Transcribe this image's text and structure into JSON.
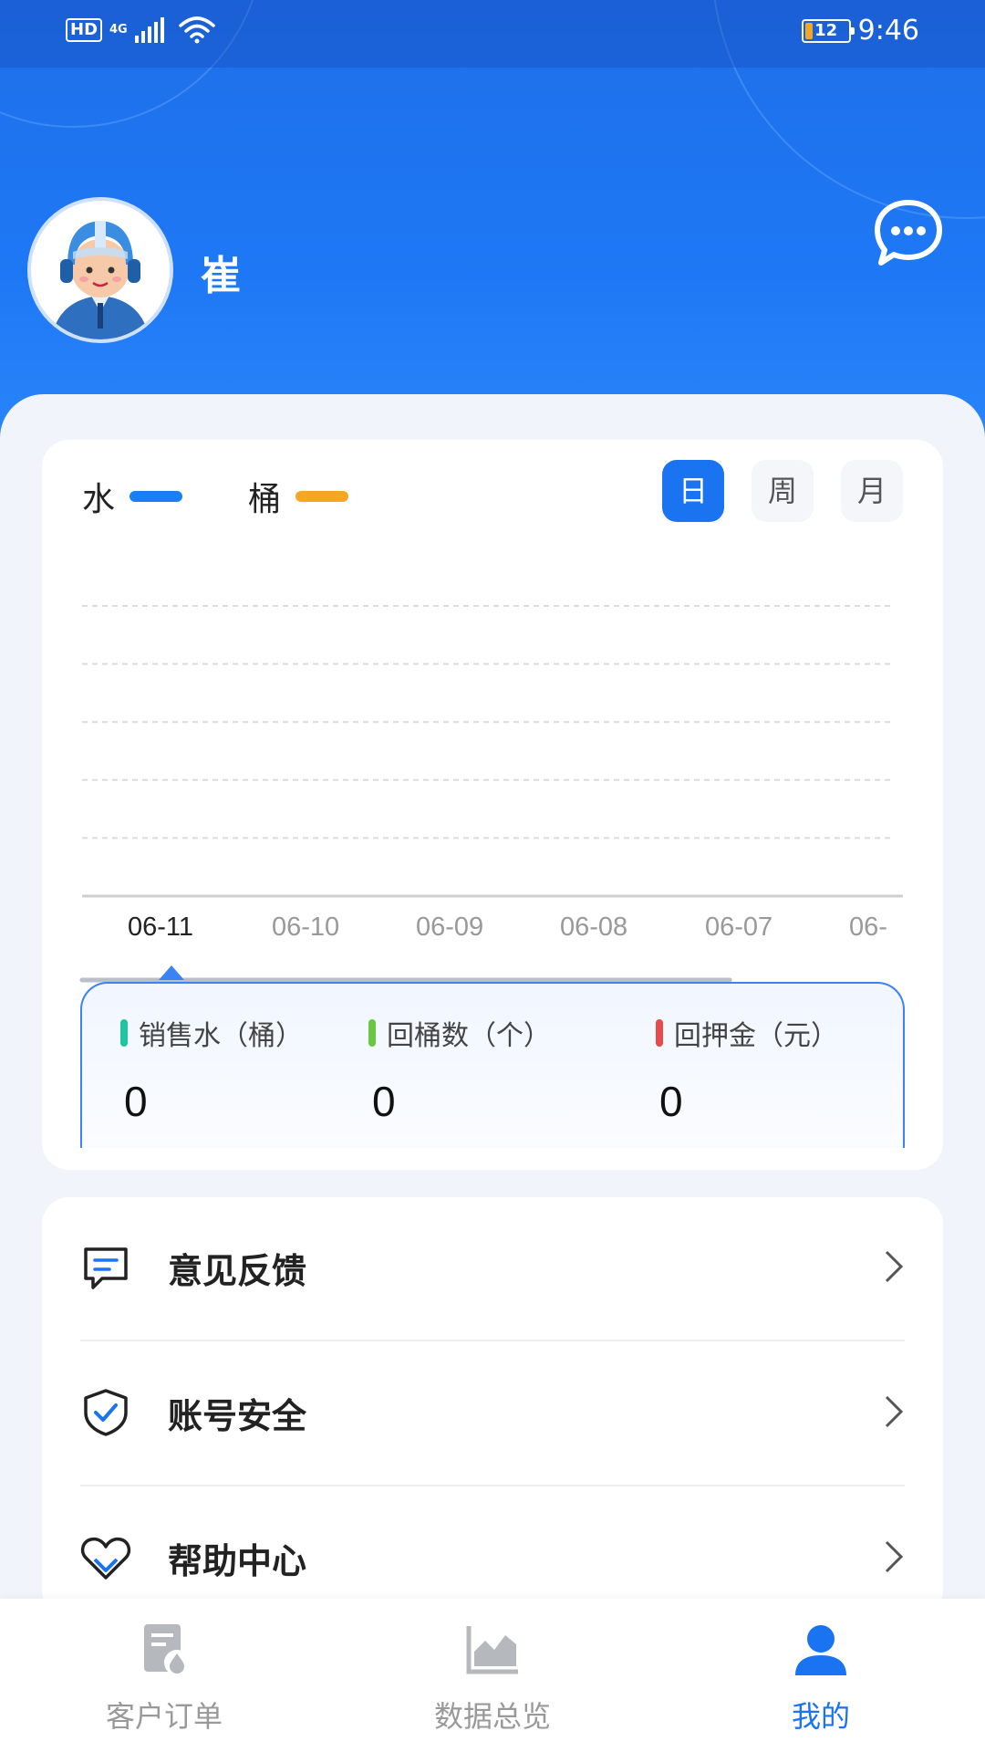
{
  "status_bar": {
    "hd": "HD",
    "network": "4G",
    "battery": "12",
    "time": "9:46"
  },
  "profile": {
    "name": "崔"
  },
  "chart_card": {
    "legend": [
      {
        "label": "水",
        "color": "#1a7ff5"
      },
      {
        "label": "桶",
        "color": "#f5a623"
      }
    ],
    "periods": [
      {
        "label": "日",
        "active": true
      },
      {
        "label": "周",
        "active": false
      },
      {
        "label": "月",
        "active": false
      }
    ],
    "dates": [
      "06-11",
      "06-10",
      "06-09",
      "06-08",
      "06-07",
      "06-"
    ],
    "selected_date": "06-11",
    "stats": [
      {
        "label": "销售水（桶）",
        "value": "0",
        "color": "#22c3a0"
      },
      {
        "label": "回桶数（个）",
        "value": "0",
        "color": "#6cc644"
      },
      {
        "label": "回押金（元）",
        "value": "0",
        "color": "#e84b4b"
      }
    ]
  },
  "chart_data": {
    "type": "bar",
    "categories": [
      "06-11",
      "06-10",
      "06-09",
      "06-08",
      "06-07",
      "06-"
    ],
    "series": [
      {
        "name": "水",
        "values": [
          0,
          0,
          0,
          0,
          0,
          0
        ]
      },
      {
        "name": "桶",
        "values": [
          0,
          0,
          0,
          0,
          0,
          0
        ]
      }
    ],
    "grid": true,
    "legend": "top-left"
  },
  "menu": [
    {
      "label": "意见反馈",
      "icon": "feedback-icon"
    },
    {
      "label": "账号安全",
      "icon": "shield-check-icon"
    },
    {
      "label": "帮助中心",
      "icon": "heart-help-icon"
    }
  ],
  "bottom_nav": [
    {
      "label": "客户订单",
      "icon": "order-icon",
      "active": false
    },
    {
      "label": "数据总览",
      "icon": "chart-icon",
      "active": false
    },
    {
      "label": "我的",
      "icon": "user-icon",
      "active": true
    }
  ],
  "colors": {
    "accent": "#1a73f0",
    "header": "#1e78f5"
  }
}
